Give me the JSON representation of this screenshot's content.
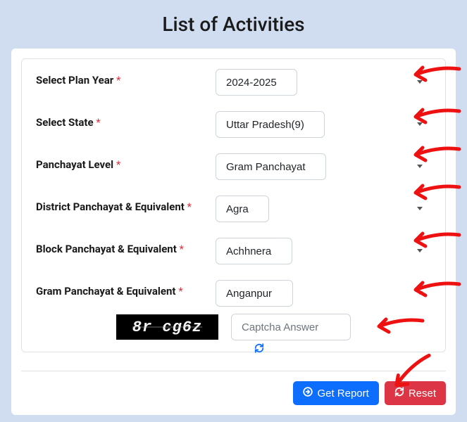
{
  "title": "List of Activities",
  "fields": {
    "plan_year": {
      "label": "Select Plan Year",
      "value": "2024-2025",
      "required": true
    },
    "state": {
      "label": "Select State",
      "value": "Uttar Pradesh(9)",
      "required": true
    },
    "level": {
      "label": "Panchayat Level",
      "value": "Gram Panchayat",
      "required": true
    },
    "district": {
      "label": "District Panchayat & Equivalent",
      "value": "Agra",
      "required": true
    },
    "block": {
      "label": "Block Panchayat & Equivalent",
      "value": "Achhnera",
      "required": true
    },
    "gram": {
      "label": "Gram Panchayat & Equivalent",
      "value": "Anganpur",
      "required": true
    }
  },
  "captcha": {
    "image_text": "8r cg6z",
    "placeholder": "Captcha Answer"
  },
  "buttons": {
    "get_report": "Get Report",
    "reset": "Reset"
  }
}
